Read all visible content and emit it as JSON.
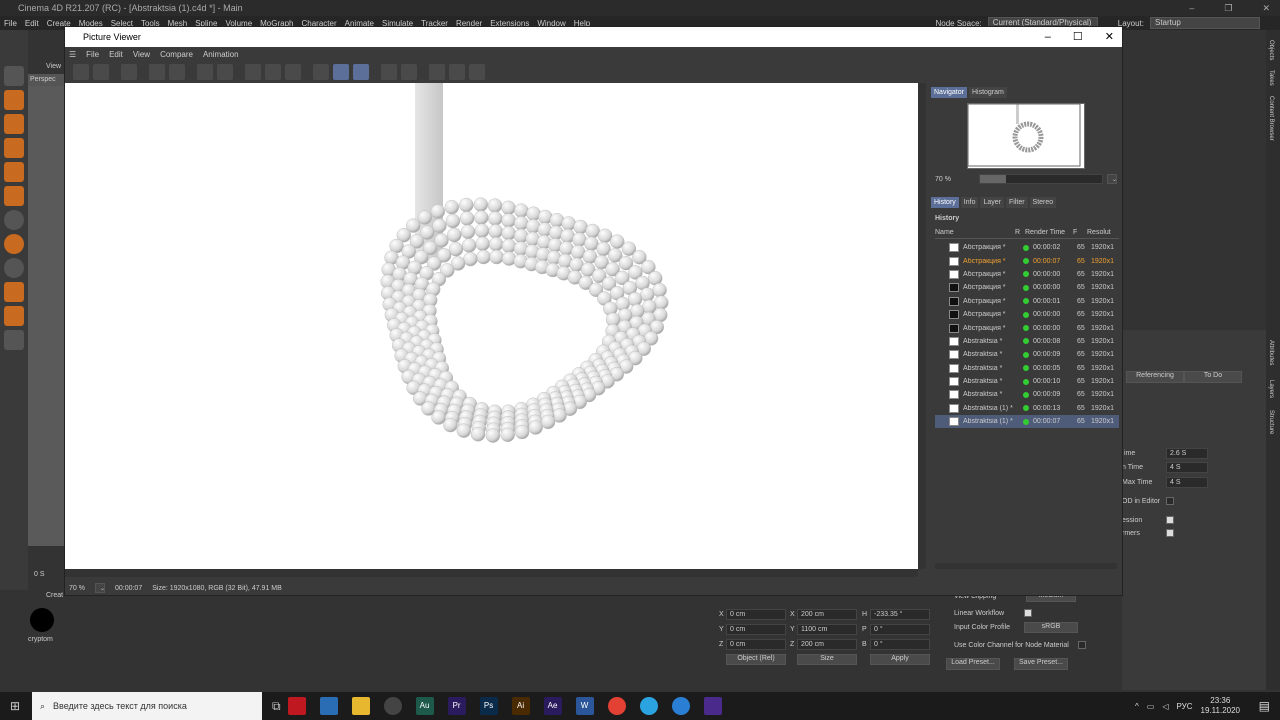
{
  "c4d": {
    "title": "Cinema 4D R21.207 (RC) - [Abstraktsia (1).c4d *] - Main",
    "menu": [
      "File",
      "Edit",
      "Create",
      "Modes",
      "Select",
      "Tools",
      "Mesh",
      "Spline",
      "Volume",
      "MoGraph",
      "Character",
      "Animate",
      "Simulate",
      "Tracker",
      "Render",
      "Extensions",
      "Window",
      "Help"
    ],
    "node_space_label": "Node Space:",
    "node_space_value": "Current (Standard/Physical)",
    "layout_label": "Layout:",
    "layout_value": "Startup",
    "view_label": "View",
    "perspective_label": "Perspec",
    "frame_label": "0 S",
    "material_label": "cryptom",
    "bottom_menu_label": "Creat",
    "coords": {
      "x_label": "X",
      "x_val": "0 cm",
      "y_label": "Y",
      "y_val": "0 cm",
      "z_label": "Z",
      "z_val": "0 cm",
      "sx_label": "X",
      "sx_val": "200 cm",
      "sy_label": "Y",
      "sy_val": "1100 cm",
      "sz_label": "Z",
      "sz_val": "200 cm",
      "h_label": "H",
      "h_val": "-233.35 °",
      "p_label": "P",
      "p_val": "0 °",
      "b_label": "B",
      "b_val": "0 °",
      "mode": "Object (Rel)",
      "size_mode": "Size",
      "apply": "Apply"
    },
    "attributes": {
      "referencing": "Referencing",
      "todo": "To Do",
      "ime_label": "ime",
      "ime_val": "2.6 S",
      "ntime_label": "n Time",
      "ntime_val": "4 S",
      "maxtime_label": "Max Time",
      "maxtime_val": "4 S",
      "lod_label": "OD in Editor",
      "ession_label": "ession",
      "ormers_label": "rmers",
      "linear_workflow": "Linear Workflow",
      "input_color_profile": "Input Color Profile",
      "input_color_value": "sRGB",
      "use_color_channel": "Use Color Channel for Node Material",
      "load_preset": "Load Preset...",
      "save_preset": "Save Preset...",
      "view_clipping": "View Clipping",
      "view_clipping_val": "Medium"
    },
    "side_tabs": [
      "Objects",
      "Takes",
      "Content Browser",
      "Attributes",
      "Layers",
      "Structure"
    ]
  },
  "pv": {
    "title": "Picture Viewer",
    "menu": [
      "File",
      "Edit",
      "View",
      "Compare",
      "Animation"
    ],
    "zoom": "70 %",
    "status_zoom": "70 %",
    "status_time": "00:00:07",
    "status_info": "Size: 1920x1080, RGB (32 Bit), 47.91 MB",
    "nav_tabs": [
      "Navigator",
      "Histogram"
    ],
    "hist_tabs": [
      "History",
      "Info",
      "Layer",
      "Filter",
      "Stereo"
    ],
    "history_label": "History",
    "columns": {
      "name": "Name",
      "r": "R",
      "time": "Render Time",
      "f": "F",
      "res": "Resolut"
    },
    "rows": [
      {
        "name": "Абстракция *",
        "time": "00:00:02",
        "f": "65",
        "res": "1920x1"
      },
      {
        "name": "Абстракция *",
        "time": "00:00:07",
        "f": "65",
        "res": "1920x1"
      },
      {
        "name": "Абстракция *",
        "time": "00:00:00",
        "f": "65",
        "res": "1920x1"
      },
      {
        "name": "Абстракция *",
        "time": "00:00:00",
        "f": "65",
        "res": "1920x1"
      },
      {
        "name": "Абстракция *",
        "time": "00:00:01",
        "f": "65",
        "res": "1920x1"
      },
      {
        "name": "Абстракция *",
        "time": "00:00:00",
        "f": "65",
        "res": "1920x1"
      },
      {
        "name": "Абстракция *",
        "time": "00:00:00",
        "f": "65",
        "res": "1920x1"
      },
      {
        "name": "Abstraktsia *",
        "time": "00:00:08",
        "f": "65",
        "res": "1920x1"
      },
      {
        "name": "Abstraktsia *",
        "time": "00:00:09",
        "f": "65",
        "res": "1920x1"
      },
      {
        "name": "Abstraktsia *",
        "time": "00:00:05",
        "f": "65",
        "res": "1920x1"
      },
      {
        "name": "Abstraktsia *",
        "time": "00:00:10",
        "f": "65",
        "res": "1920x1"
      },
      {
        "name": "Abstraktsia *",
        "time": "00:00:09",
        "f": "65",
        "res": "1920x1"
      },
      {
        "name": "Abstraktsia (1) *",
        "time": "00:00:13",
        "f": "65",
        "res": "1920x1"
      },
      {
        "name": "Abstraktsia (1) *",
        "time": "00:00:07",
        "f": "65",
        "res": "1920x1"
      }
    ]
  },
  "taskbar": {
    "search_placeholder": "Введите здесь текст для поиска",
    "lang": "РУС",
    "time": "23:36",
    "date": "19.11.2020",
    "apps": [
      {
        "name": "au",
        "label": "Au",
        "color": "#1d5a4c"
      },
      {
        "name": "premiere",
        "label": "Pr",
        "color": "#2a1a5e"
      },
      {
        "name": "photoshop",
        "label": "Ps",
        "color": "#0a2a4a"
      },
      {
        "name": "illustrator",
        "label": "Ai",
        "color": "#4a2a00"
      },
      {
        "name": "aftereffects",
        "label": "Ae",
        "color": "#2a1a5e"
      },
      {
        "name": "word",
        "label": "W",
        "color": "#2b579a"
      }
    ]
  }
}
